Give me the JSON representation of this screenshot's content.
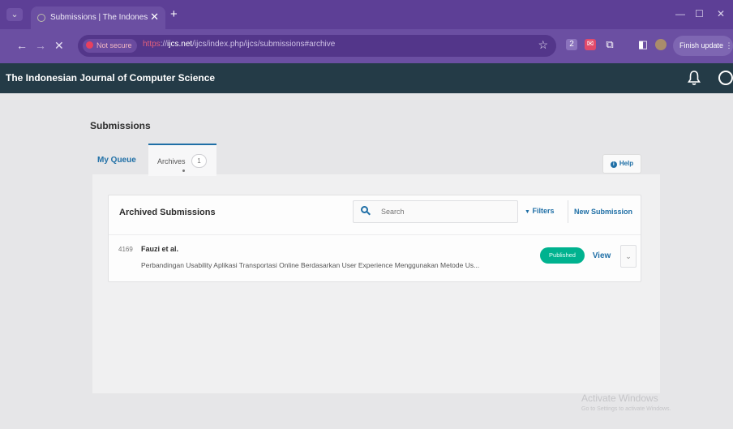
{
  "browser": {
    "tab_title": "Submissions | The Indonesian J",
    "tab_close": "✕",
    "new_tab": "+",
    "security_label": "Not secure",
    "url_protocol": "https",
    "url_rest_sep": "://",
    "url_host": "ijcs.net",
    "url_path": "/ijcs/index.php/ijcs/submissions#archive",
    "finish_update": "Finish update",
    "win_minimize": "—",
    "win_maximize": "☐",
    "win_close": "✕",
    "icons": [
      "back-icon",
      "forward-icon",
      "close-icon",
      "star-icon",
      "extension-icon",
      "profile-icon"
    ]
  },
  "appbar": {
    "brand": "The Indonesian Journal of Computer Science",
    "icons": [
      "bell-icon",
      "user-icon"
    ]
  },
  "page": {
    "title": "Submissions",
    "tabs": [
      {
        "label": "My Queue"
      },
      {
        "label": "Archives",
        "count": "1"
      }
    ],
    "help_label": "Help",
    "help_icon": "i"
  },
  "archived": {
    "title": "Archived Submissions",
    "search_placeholder": "Search",
    "filters_label": "Filters",
    "filters_icon": "▼",
    "new_submission_label": "New Submission",
    "rows": [
      {
        "id": "4169",
        "author": "Fauzi et al.",
        "title": "Perbandingan Usability Aplikasi Transportasi Online Berdasarkan User Experience Menggunakan Metode Us...",
        "status": "Published",
        "status_color": "#00b28f",
        "view_label": "View",
        "expand_icon": "⌄"
      }
    ]
  },
  "os_watermark": {
    "line1": "Activate Windows",
    "line2": "Go to Settings to activate Windows."
  }
}
